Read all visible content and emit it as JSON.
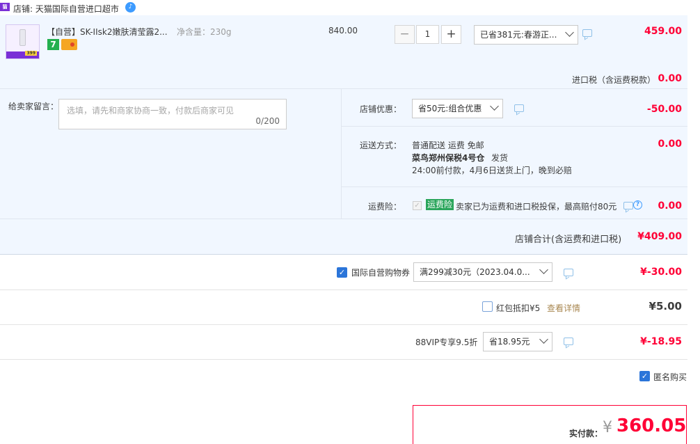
{
  "store": {
    "badge": "tmall",
    "label": "店铺: 天猫国际自营进口超市",
    "wangwang_icon": "wangwang-chat-icon"
  },
  "item": {
    "title": "【自营】SK-IIsk2嫩肤清莹露2...",
    "sku": "净含量：230g",
    "thumb_badge": "399",
    "unit_price": "840.00",
    "quantity": "1",
    "minus": "−",
    "plus": "+",
    "promotion": "已省381元:春游正...",
    "subtotal": "459.00",
    "import_tax_label": "进口税（含运费税款）",
    "import_tax_value": "0.00"
  },
  "options": {
    "message_label": "给卖家留言：",
    "message_placeholder": "选填，请先和商家协商一致，付款后商家可见",
    "message_count": "0/200",
    "shop_discount_label": "店铺优惠：",
    "shop_discount_select": "省50元:组合优惠",
    "shop_discount_value": "-50.00",
    "shipping_label": "运送方式：",
    "shipping_line1": "普通配送 运费 免邮",
    "shipping_line2_bold": "菜鸟郑州保税4号仓",
    "shipping_line2_rest": "发货",
    "shipping_line3": "24:00前付款，4月6日送货上门，晚到必赔",
    "shipping_value": "0.00",
    "insurance_label": "运费险：",
    "insurance_tag": "运费险",
    "insurance_text": "卖家已为运费和进口税投保，最高赔付80元",
    "insurance_value": "0.00",
    "shop_total_label": "店铺合计(含运费和进口税)",
    "shop_total_value": "¥409.00"
  },
  "coupon_row": {
    "label": "国际自营购物券",
    "select": "满299减30元（2023.04.0...",
    "value": "¥-30.00"
  },
  "redpacket_row": {
    "label": "红包抵扣¥5",
    "link": "查看详情",
    "value": "¥5.00"
  },
  "vip_row": {
    "label": "88VIP专享9.5折",
    "select": "省18.95元",
    "value": "¥-18.95"
  },
  "anonymous": {
    "label": "匿名购买"
  },
  "payment": {
    "label": "实付款：",
    "currency": "¥",
    "amount": "360.05"
  }
}
